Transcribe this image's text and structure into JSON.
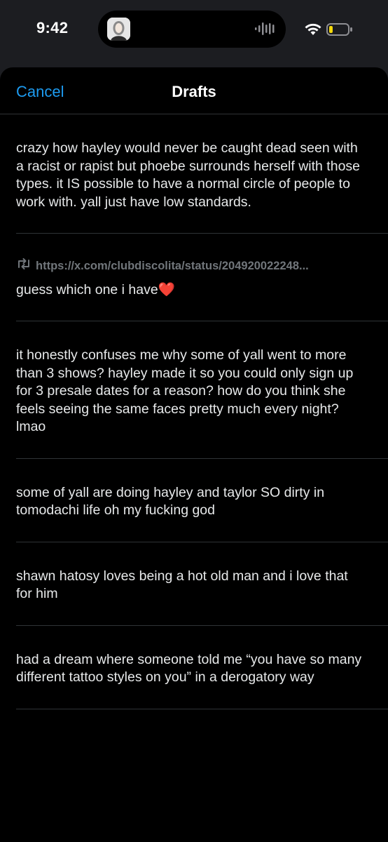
{
  "status_bar": {
    "time": "9:42",
    "icons": [
      "profile-thumbnail",
      "audio-wave-icon",
      "wifi-icon",
      "battery-low-icon"
    ]
  },
  "header": {
    "cancel_label": "Cancel",
    "title": "Drafts"
  },
  "drafts": [
    {
      "text": "crazy how hayley would never be caught dead seen with a racist or rapist but phoebe surrounds herself with those types. it IS possible to have a normal circle of people to work with. yall just have low standards."
    },
    {
      "quote_url": "https://x.com/clubdiscolita/status/204920022248...",
      "text": "guess which one i have",
      "emoji": "❤️"
    },
    {
      "text": "it honestly confuses me why some of yall went to more than 3 shows? hayley made it so you could only sign up for 3 presale dates for a reason? how do you think she feels seeing the same faces pretty much every night? lmao"
    },
    {
      "text": "some of yall are doing hayley and taylor SO dirty in tomodachi life oh my fucking god"
    },
    {
      "text": "shawn hatosy loves being a hot old man and i love that for him"
    },
    {
      "text": "had a dream where someone told me “you have so many different tattoo styles on you” in a derogatory way"
    }
  ],
  "colors": {
    "background": "#000000",
    "accent": "#1d9bf0",
    "divider": "#2f3336",
    "secondary_text": "#71767b",
    "battery_low": "#f5d90a"
  }
}
